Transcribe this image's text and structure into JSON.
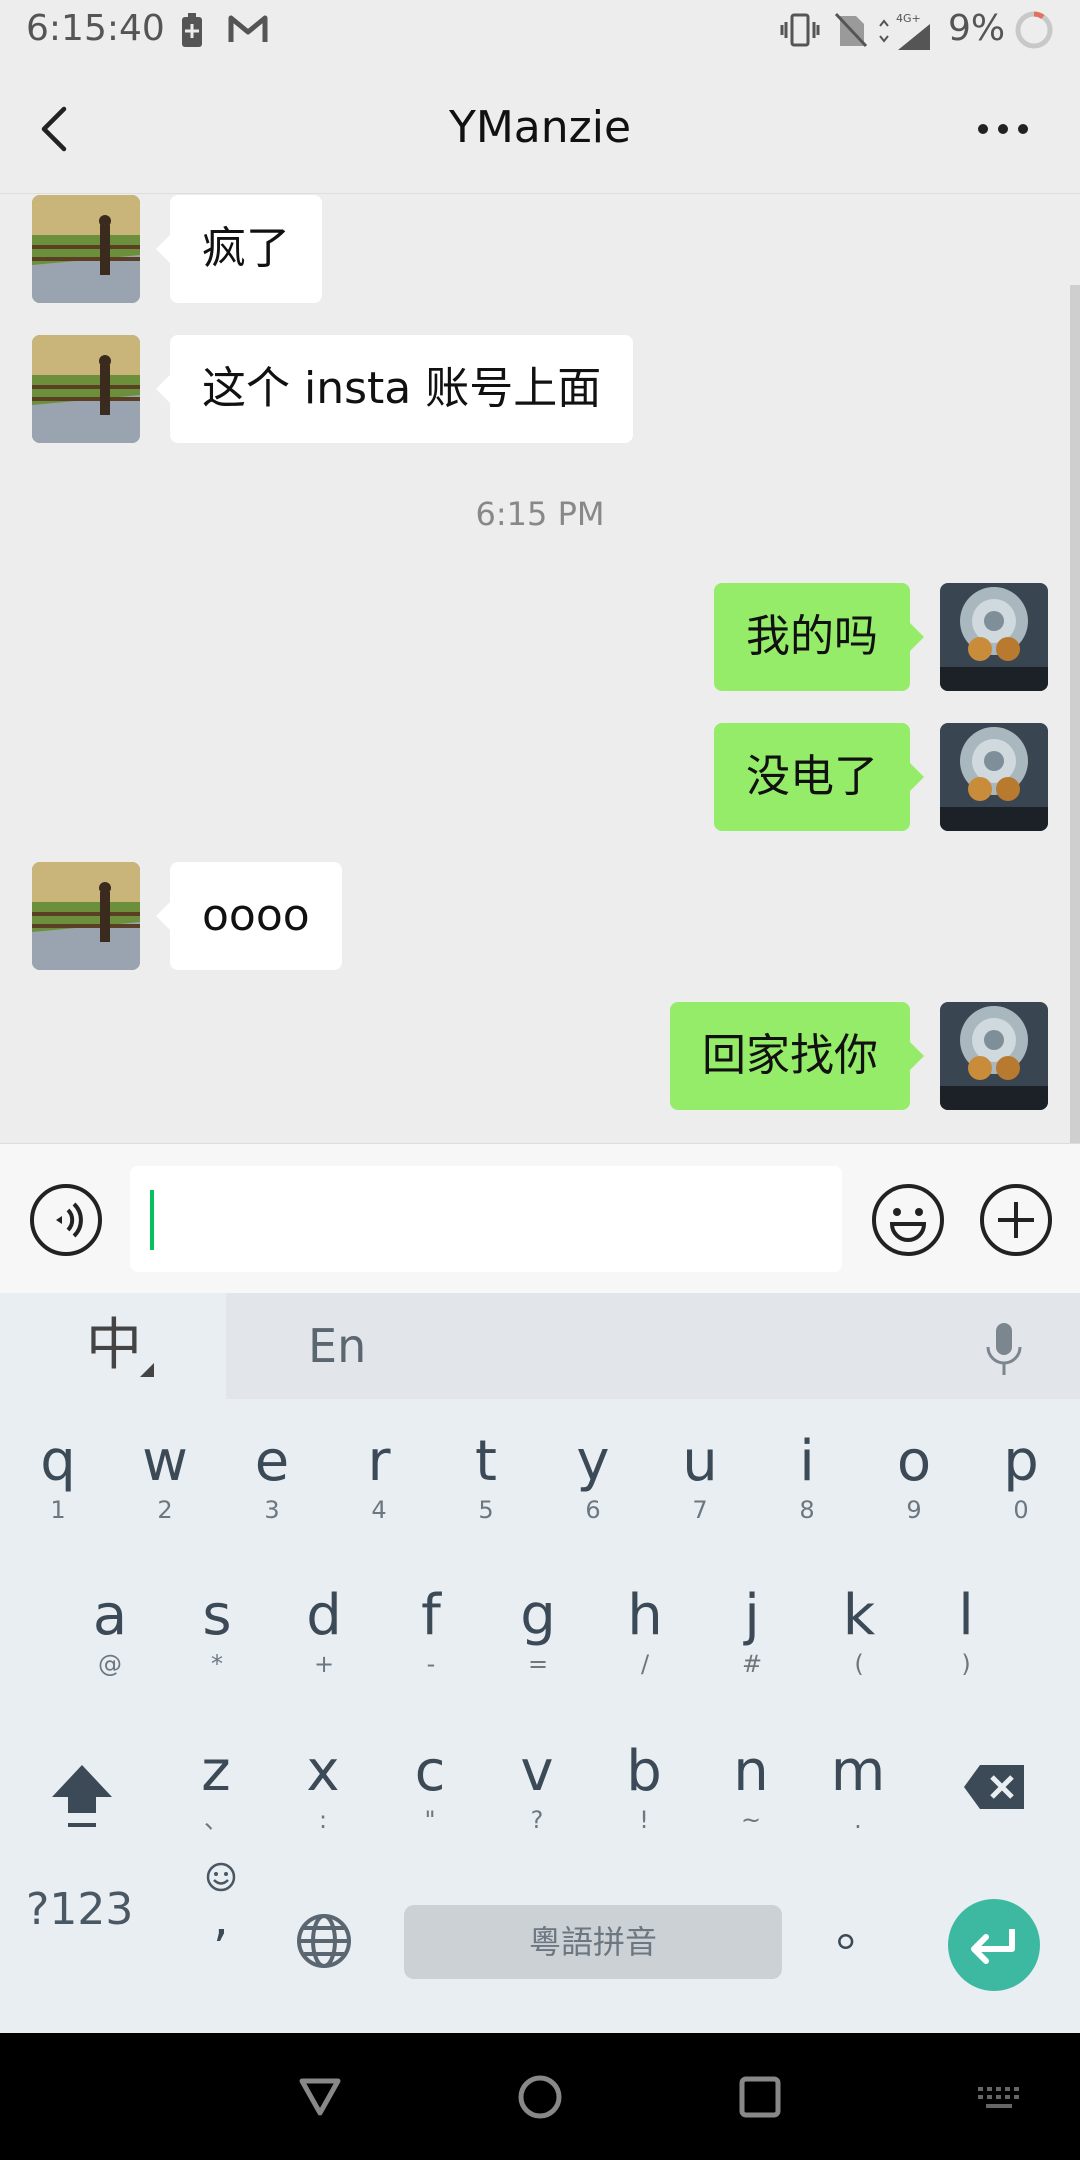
{
  "status_bar": {
    "time": "6:15:40",
    "network": "4G+",
    "battery_percent": "9%",
    "icons": [
      "battery-saver-icon",
      "gmail-icon",
      "vibrate-icon",
      "no-sim-icon",
      "signal-icon",
      "battery-ring-icon"
    ]
  },
  "header": {
    "title": "YManzie",
    "back_icon": "chevron-left-icon",
    "more_icon": "more-dots-icon"
  },
  "messages": [
    {
      "side": "in",
      "text": "疯了"
    },
    {
      "side": "in",
      "text": "这个 insta 账号上面"
    },
    {
      "side": "out",
      "text": "我的吗"
    },
    {
      "side": "out",
      "text": "没电了"
    },
    {
      "side": "in",
      "text": "oooo"
    },
    {
      "side": "out",
      "text": "回家找你"
    }
  ],
  "timestamp": "6:15 PM",
  "input_bar": {
    "voice_icon": "voice-icon",
    "emoji_icon": "emoji-icon",
    "add_icon": "plus-icon",
    "value": ""
  },
  "keyboard": {
    "lang_zh": "中",
    "lang_en": "En",
    "row1": [
      {
        "k": "q",
        "s": "1"
      },
      {
        "k": "w",
        "s": "2"
      },
      {
        "k": "e",
        "s": "3"
      },
      {
        "k": "r",
        "s": "4"
      },
      {
        "k": "t",
        "s": "5"
      },
      {
        "k": "y",
        "s": "6"
      },
      {
        "k": "u",
        "s": "7"
      },
      {
        "k": "i",
        "s": "8"
      },
      {
        "k": "o",
        "s": "9"
      },
      {
        "k": "p",
        "s": "0"
      }
    ],
    "row2": [
      {
        "k": "a",
        "s": "@"
      },
      {
        "k": "s",
        "s": "*"
      },
      {
        "k": "d",
        "s": "+"
      },
      {
        "k": "f",
        "s": "-"
      },
      {
        "k": "g",
        "s": "="
      },
      {
        "k": "h",
        "s": "/"
      },
      {
        "k": "j",
        "s": "#"
      },
      {
        "k": "k",
        "s": "("
      },
      {
        "k": "l",
        "s": ")"
      }
    ],
    "row3": [
      {
        "k": "z",
        "s": "、"
      },
      {
        "k": "x",
        "s": ":"
      },
      {
        "k": "c",
        "s": "\""
      },
      {
        "k": "v",
        "s": "?"
      },
      {
        "k": "b",
        "s": "!"
      },
      {
        "k": "n",
        "s": "~"
      },
      {
        "k": "m",
        "s": "."
      }
    ],
    "symbols_label": "?123",
    "comma_label": ",",
    "space_label": "粵語拼音",
    "period_label": "。"
  },
  "colors": {
    "outgoing_bubble": "#95ec69",
    "incoming_bubble": "#ffffff",
    "enter_key": "#3db9a2",
    "caret": "#07c160"
  }
}
